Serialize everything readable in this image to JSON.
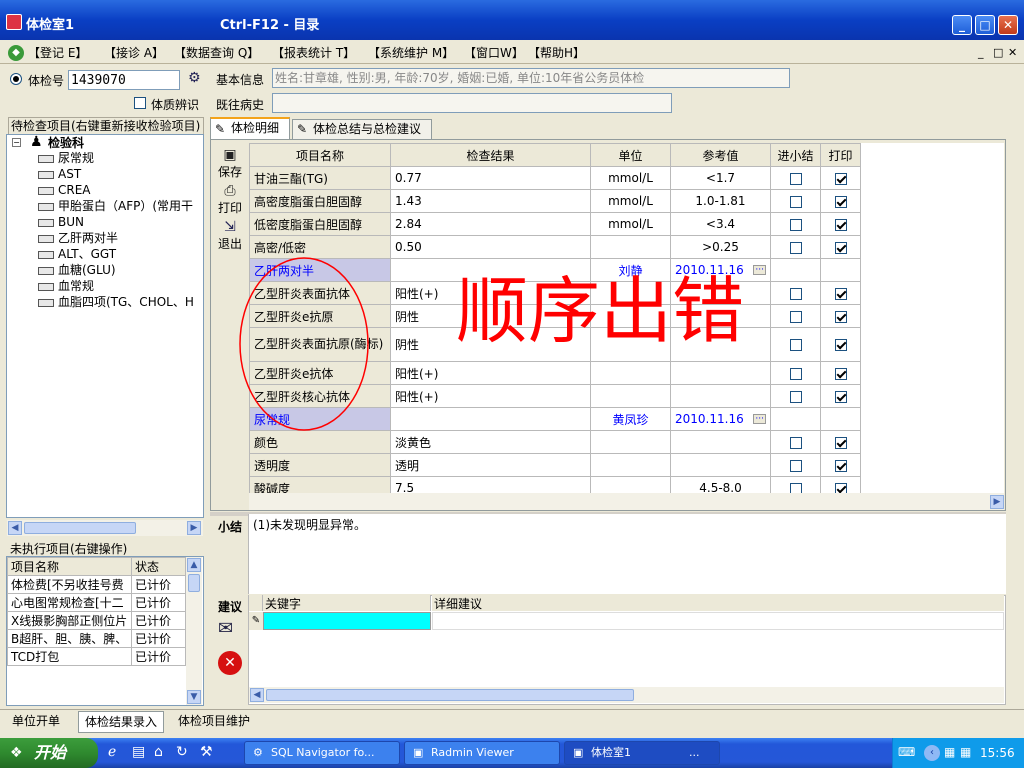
{
  "window": {
    "title": "体检室1",
    "subtitle": "Ctrl-F12 - 目录"
  },
  "menu": [
    "【登记 E】",
    "【接诊 A】",
    "【数据查询 Q】",
    "【报表统计 T】",
    "【系统维护 M】",
    "【窗口W】",
    "【帮助H】"
  ],
  "left": {
    "id_label": "体检号",
    "id_value": "1439070",
    "physique_label": "体质辨识",
    "pending_header": "待检查项目(右键重新接收检验项目)",
    "tree_root": "检验科",
    "tree_items": [
      "尿常规",
      "AST",
      "CREA",
      "甲胎蛋白（AFP）(常用干",
      "BUN",
      "乙肝两对半",
      "ALT、GGT",
      "血糖(GLU)",
      "血常规",
      "血脂四项(TG、CHOL、H"
    ],
    "unexec_header": "未执行项目(右键操作)",
    "unexec_columns": [
      "项目名称",
      "状态"
    ],
    "unexec_rows": [
      [
        "体检费[不另收挂号费",
        "已计价"
      ],
      [
        "心电图常规检查[十二",
        "已计价"
      ],
      [
        "X线摄影胸部正侧位片",
        "已计价"
      ],
      [
        "B超肝、胆、胰、脾、",
        "已计价"
      ],
      [
        "TCD打包",
        "已计价"
      ]
    ]
  },
  "info": {
    "basic_label": "基本信息",
    "basic_value": "姓名:甘章雄, 性别:男, 年龄:70岁, 婚姻:已婚, 单位:10年省公务员体检",
    "history_label": "既往病史",
    "history_value": ""
  },
  "tabs": [
    "体检明细",
    "体检总结与总检建议"
  ],
  "actions": {
    "save": "保存",
    "print": "打印",
    "exit": "退出"
  },
  "grid": {
    "columns": [
      "项目名称",
      "检查结果",
      "单位",
      "参考值",
      "进小结",
      "打印"
    ],
    "rows": [
      {
        "type": "item",
        "name": "甘油三酯(TG)",
        "result": "0.77",
        "unit": "mmol/L",
        "ref": "<1.7",
        "summary": false,
        "print": true
      },
      {
        "type": "item",
        "name": "高密度脂蛋白胆固醇",
        "result": "1.43",
        "unit": "mmol/L",
        "ref": "1.0-1.81",
        "summary": false,
        "print": true
      },
      {
        "type": "item",
        "name": "低密度脂蛋白胆固醇",
        "result": "2.84",
        "unit": "mmol/L",
        "ref": "<3.4",
        "summary": false,
        "print": true
      },
      {
        "type": "item",
        "name": "高密/低密",
        "result": "0.50",
        "unit": "",
        "ref": ">0.25",
        "summary": false,
        "print": true
      },
      {
        "type": "group",
        "name": "乙肝两对半",
        "doctor": "刘静",
        "date": "2010.11.16"
      },
      {
        "type": "item",
        "name": "乙型肝炎表面抗体",
        "result": "阳性(+)",
        "unit": "",
        "ref": "",
        "summary": false,
        "print": true
      },
      {
        "type": "item",
        "name": "乙型肝炎e抗原",
        "result": "阴性",
        "unit": "",
        "ref": "",
        "summary": false,
        "print": true
      },
      {
        "type": "item",
        "name": "乙型肝炎表面抗原(酶标)",
        "result": "阴性",
        "unit": "",
        "ref": "",
        "summary": false,
        "print": true
      },
      {
        "type": "item",
        "name": "乙型肝炎e抗体",
        "result": "阳性(+)",
        "unit": "",
        "ref": "",
        "summary": false,
        "print": true
      },
      {
        "type": "item",
        "name": "乙型肝炎核心抗体",
        "result": "阳性(+)",
        "unit": "",
        "ref": "",
        "summary": false,
        "print": true
      },
      {
        "type": "group",
        "name": "尿常规",
        "doctor": "黄凤珍",
        "date": "2010.11.16"
      },
      {
        "type": "item",
        "name": "颜色",
        "result": "淡黄色",
        "unit": "",
        "ref": "",
        "summary": false,
        "print": true
      },
      {
        "type": "item",
        "name": "透明度",
        "result": "透明",
        "unit": "",
        "ref": "",
        "summary": false,
        "print": true
      },
      {
        "type": "item",
        "name": "酸碱度",
        "result": "7.5",
        "unit": "",
        "ref": "4.5-8.0",
        "summary": false,
        "print": true
      }
    ]
  },
  "annotation": "顺序出错",
  "summary_label": "小结",
  "summary_text": "(1)未发现明显异常。",
  "advice_label": "建议",
  "advice_columns": [
    "关键字",
    "详细建议"
  ],
  "status_tabs": [
    "单位开单",
    "体检结果录入",
    "体检项目维护"
  ],
  "taskbar": {
    "start": "开始",
    "tasks": [
      "SQL Navigator fo...",
      "Radmin Viewer",
      "体检室1",
      "..."
    ],
    "clock": "15:56"
  },
  "colors": {
    "title_blue": "#0a3fc4",
    "group_row": "#c8c8e6",
    "advice_cyan": "#00ffff",
    "annotation_red": "#ff0000"
  }
}
